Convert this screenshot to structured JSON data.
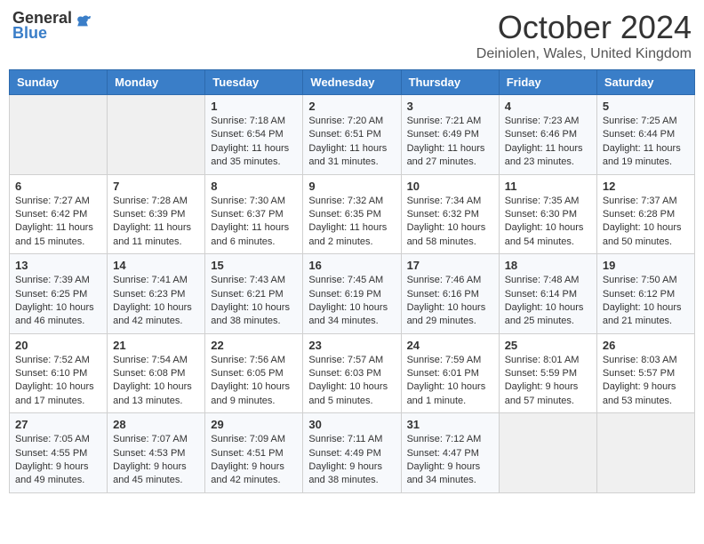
{
  "logo": {
    "general": "General",
    "blue": "Blue"
  },
  "header": {
    "month_title": "October 2024",
    "subtitle": "Deiniolen, Wales, United Kingdom"
  },
  "weekdays": [
    "Sunday",
    "Monday",
    "Tuesday",
    "Wednesday",
    "Thursday",
    "Friday",
    "Saturday"
  ],
  "weeks": [
    [
      {
        "day": "",
        "info": ""
      },
      {
        "day": "",
        "info": ""
      },
      {
        "day": "1",
        "info": "Sunrise: 7:18 AM\nSunset: 6:54 PM\nDaylight: 11 hours and 35 minutes."
      },
      {
        "day": "2",
        "info": "Sunrise: 7:20 AM\nSunset: 6:51 PM\nDaylight: 11 hours and 31 minutes."
      },
      {
        "day": "3",
        "info": "Sunrise: 7:21 AM\nSunset: 6:49 PM\nDaylight: 11 hours and 27 minutes."
      },
      {
        "day": "4",
        "info": "Sunrise: 7:23 AM\nSunset: 6:46 PM\nDaylight: 11 hours and 23 minutes."
      },
      {
        "day": "5",
        "info": "Sunrise: 7:25 AM\nSunset: 6:44 PM\nDaylight: 11 hours and 19 minutes."
      }
    ],
    [
      {
        "day": "6",
        "info": "Sunrise: 7:27 AM\nSunset: 6:42 PM\nDaylight: 11 hours and 15 minutes."
      },
      {
        "day": "7",
        "info": "Sunrise: 7:28 AM\nSunset: 6:39 PM\nDaylight: 11 hours and 11 minutes."
      },
      {
        "day": "8",
        "info": "Sunrise: 7:30 AM\nSunset: 6:37 PM\nDaylight: 11 hours and 6 minutes."
      },
      {
        "day": "9",
        "info": "Sunrise: 7:32 AM\nSunset: 6:35 PM\nDaylight: 11 hours and 2 minutes."
      },
      {
        "day": "10",
        "info": "Sunrise: 7:34 AM\nSunset: 6:32 PM\nDaylight: 10 hours and 58 minutes."
      },
      {
        "day": "11",
        "info": "Sunrise: 7:35 AM\nSunset: 6:30 PM\nDaylight: 10 hours and 54 minutes."
      },
      {
        "day": "12",
        "info": "Sunrise: 7:37 AM\nSunset: 6:28 PM\nDaylight: 10 hours and 50 minutes."
      }
    ],
    [
      {
        "day": "13",
        "info": "Sunrise: 7:39 AM\nSunset: 6:25 PM\nDaylight: 10 hours and 46 minutes."
      },
      {
        "day": "14",
        "info": "Sunrise: 7:41 AM\nSunset: 6:23 PM\nDaylight: 10 hours and 42 minutes."
      },
      {
        "day": "15",
        "info": "Sunrise: 7:43 AM\nSunset: 6:21 PM\nDaylight: 10 hours and 38 minutes."
      },
      {
        "day": "16",
        "info": "Sunrise: 7:45 AM\nSunset: 6:19 PM\nDaylight: 10 hours and 34 minutes."
      },
      {
        "day": "17",
        "info": "Sunrise: 7:46 AM\nSunset: 6:16 PM\nDaylight: 10 hours and 29 minutes."
      },
      {
        "day": "18",
        "info": "Sunrise: 7:48 AM\nSunset: 6:14 PM\nDaylight: 10 hours and 25 minutes."
      },
      {
        "day": "19",
        "info": "Sunrise: 7:50 AM\nSunset: 6:12 PM\nDaylight: 10 hours and 21 minutes."
      }
    ],
    [
      {
        "day": "20",
        "info": "Sunrise: 7:52 AM\nSunset: 6:10 PM\nDaylight: 10 hours and 17 minutes."
      },
      {
        "day": "21",
        "info": "Sunrise: 7:54 AM\nSunset: 6:08 PM\nDaylight: 10 hours and 13 minutes."
      },
      {
        "day": "22",
        "info": "Sunrise: 7:56 AM\nSunset: 6:05 PM\nDaylight: 10 hours and 9 minutes."
      },
      {
        "day": "23",
        "info": "Sunrise: 7:57 AM\nSunset: 6:03 PM\nDaylight: 10 hours and 5 minutes."
      },
      {
        "day": "24",
        "info": "Sunrise: 7:59 AM\nSunset: 6:01 PM\nDaylight: 10 hours and 1 minute."
      },
      {
        "day": "25",
        "info": "Sunrise: 8:01 AM\nSunset: 5:59 PM\nDaylight: 9 hours and 57 minutes."
      },
      {
        "day": "26",
        "info": "Sunrise: 8:03 AM\nSunset: 5:57 PM\nDaylight: 9 hours and 53 minutes."
      }
    ],
    [
      {
        "day": "27",
        "info": "Sunrise: 7:05 AM\nSunset: 4:55 PM\nDaylight: 9 hours and 49 minutes."
      },
      {
        "day": "28",
        "info": "Sunrise: 7:07 AM\nSunset: 4:53 PM\nDaylight: 9 hours and 45 minutes."
      },
      {
        "day": "29",
        "info": "Sunrise: 7:09 AM\nSunset: 4:51 PM\nDaylight: 9 hours and 42 minutes."
      },
      {
        "day": "30",
        "info": "Sunrise: 7:11 AM\nSunset: 4:49 PM\nDaylight: 9 hours and 38 minutes."
      },
      {
        "day": "31",
        "info": "Sunrise: 7:12 AM\nSunset: 4:47 PM\nDaylight: 9 hours and 34 minutes."
      },
      {
        "day": "",
        "info": ""
      },
      {
        "day": "",
        "info": ""
      }
    ]
  ]
}
